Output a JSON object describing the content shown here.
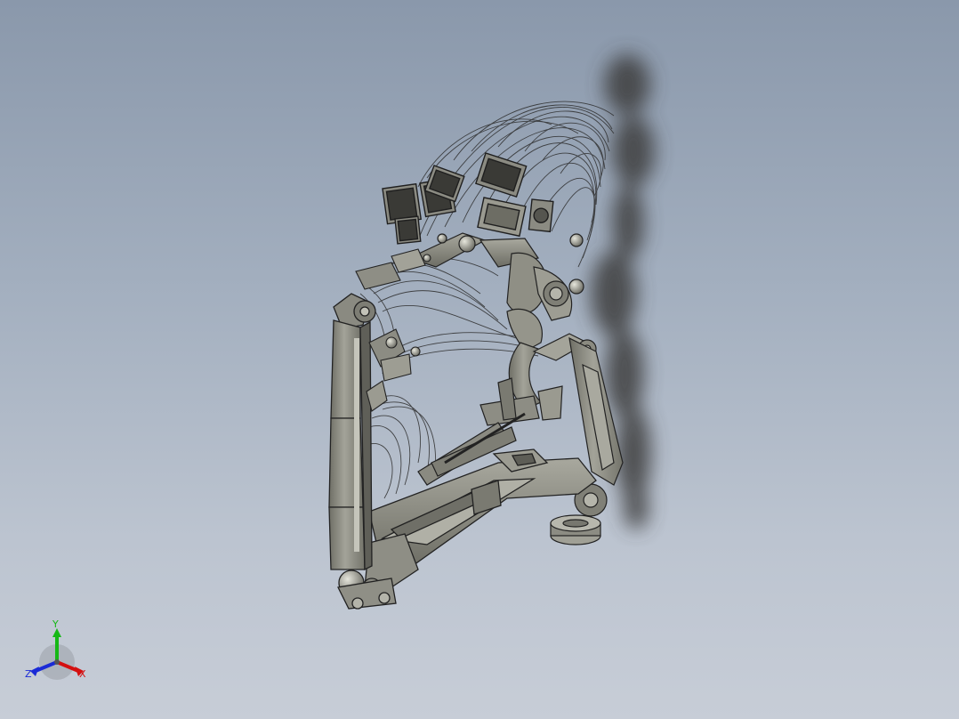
{
  "viewport": {
    "background_top": "#8a98ab",
    "background_bottom": "#c7cdd7"
  },
  "model": {
    "body_color": "#8e8e84",
    "edge_color": "#2a2a2a",
    "shadow_color": "#3c3c3c"
  },
  "triad": {
    "x_label": "X",
    "y_label": "Y",
    "z_label": "Z",
    "x_color": "#d41010",
    "y_color": "#16b816",
    "z_color": "#1a2ad6"
  }
}
